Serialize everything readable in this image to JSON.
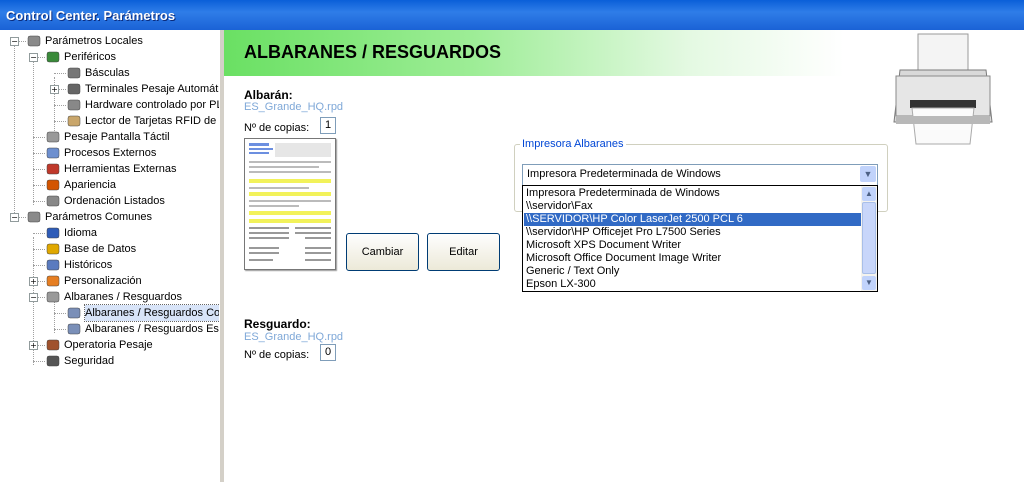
{
  "window": {
    "title": "Control Center. Parámetros"
  },
  "tree": [
    {
      "label": "Parámetros Locales",
      "level": 0,
      "expander": "−",
      "icon": "tools-icon"
    },
    {
      "label": "Periféricos",
      "level": 1,
      "expander": "−",
      "icon": "board-icon"
    },
    {
      "label": "Básculas",
      "level": 2,
      "expander": "",
      "icon": "scale-icon"
    },
    {
      "label": "Terminales Pesaje Automático",
      "level": 2,
      "expander": "+",
      "icon": "terminal-icon"
    },
    {
      "label": "Hardware controlado por PLC",
      "level": 2,
      "expander": "",
      "icon": "hardware-icon"
    },
    {
      "label": "Lector de Tarjetas RFID de",
      "level": 2,
      "expander": "",
      "icon": "card-reader-icon"
    },
    {
      "label": "Pesaje Pantalla Táctil",
      "level": 1,
      "expander": "",
      "icon": "touch-icon"
    },
    {
      "label": "Procesos Externos",
      "level": 1,
      "expander": "",
      "icon": "window-icon"
    },
    {
      "label": "Herramientas Externas",
      "level": 1,
      "expander": "",
      "icon": "toolbox-icon"
    },
    {
      "label": "Apariencia",
      "level": 1,
      "expander": "",
      "icon": "palette-icon"
    },
    {
      "label": "Ordenación Listados",
      "level": 1,
      "expander": "",
      "icon": "sort-icon"
    },
    {
      "label": "Parámetros Comunes",
      "level": 0,
      "expander": "−",
      "icon": "tools-icon"
    },
    {
      "label": "Idioma",
      "level": 1,
      "expander": "",
      "icon": "flag-icon"
    },
    {
      "label": "Base de Datos",
      "level": 1,
      "expander": "",
      "icon": "database-icon"
    },
    {
      "label": "Históricos",
      "level": 1,
      "expander": "",
      "icon": "grid-icon"
    },
    {
      "label": "Personalización",
      "level": 1,
      "expander": "+",
      "icon": "users-icon"
    },
    {
      "label": "Albaranes / Resguardos",
      "level": 1,
      "expander": "−",
      "icon": "printer-icon"
    },
    {
      "label": "Albaranes / Resguardos Co",
      "level": 2,
      "expander": "",
      "icon": "document-icon",
      "selected": true
    },
    {
      "label": "Albaranes / Resguardos Esp",
      "level": 2,
      "expander": "",
      "icon": "document-icon"
    },
    {
      "label": "Operatoria Pesaje",
      "level": 1,
      "expander": "+",
      "icon": "weigh-icon"
    },
    {
      "label": "Seguridad",
      "level": 1,
      "expander": "",
      "icon": "lock-icon"
    }
  ],
  "main": {
    "header": "ALBARANES / RESGUARDOS",
    "albaran": {
      "label": "Albarán:",
      "file": "ES_Grande_HQ.rpd",
      "copies_label": "Nº de copias:",
      "copies": "1"
    },
    "resguardo": {
      "label": "Resguardo:",
      "file": "ES_Grande_HQ.rpd",
      "copies_label": "Nº de copias:",
      "copies": "0"
    },
    "buttons": {
      "change": "Cambiar",
      "edit": "Editar"
    },
    "printer_group": {
      "label": "Impresora Albaranes",
      "selected": "Impresora Predeterminada de Windows",
      "options": [
        "Impresora Predeterminada de Windows",
        "\\\\servidor\\Fax",
        "\\\\SERVIDOR\\HP Color LaserJet 2500 PCL 6",
        "\\\\servidor\\HP Officejet Pro L7500 Series",
        "Microsoft XPS Document Writer",
        "Microsoft Office Document Image Writer",
        "Generic / Text Only",
        "Epson LX-300"
      ],
      "highlighted_index": 2
    }
  }
}
